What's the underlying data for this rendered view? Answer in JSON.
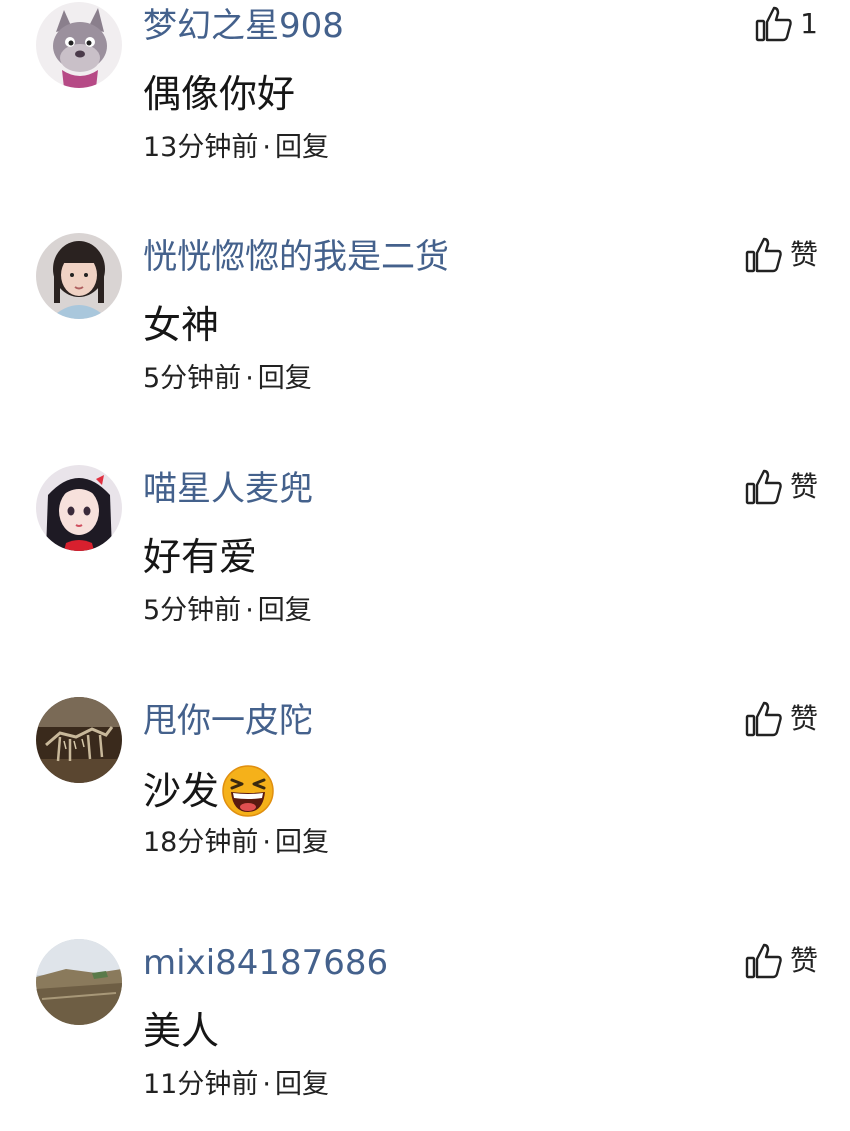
{
  "comments": [
    {
      "username": "梦幻之星908",
      "text": "偶像你好",
      "time": "13分钟前",
      "separator": "·",
      "reply": "回复",
      "like_label": "1",
      "avatar": "cartoon-wolf-avatar"
    },
    {
      "username": "恍恍惚惚的我是二货",
      "text": "女神",
      "time": "5分钟前",
      "separator": "·",
      "reply": "回复",
      "like_label": "赞",
      "avatar": "girl-photo-avatar"
    },
    {
      "username": "喵星人麦兜",
      "text": "好有爱",
      "time": "5分钟前",
      "separator": "·",
      "reply": "回复",
      "like_label": "赞",
      "avatar": "anime-girl-avatar"
    },
    {
      "username": "甩你一皮陀",
      "text": "沙发",
      "emoji": "laughing-emoji",
      "time": "18分钟前",
      "separator": "·",
      "reply": "回复",
      "like_label": "赞",
      "avatar": "dinosaur-skeleton-avatar"
    },
    {
      "username": "mixi84187686",
      "text": "美人",
      "time": "11分钟前",
      "separator": "·",
      "reply": "回复",
      "like_label": "赞",
      "avatar": "landscape-avatar"
    }
  ],
  "colors": {
    "username": "#44618c",
    "text": "#161616",
    "meta": "#222222"
  }
}
